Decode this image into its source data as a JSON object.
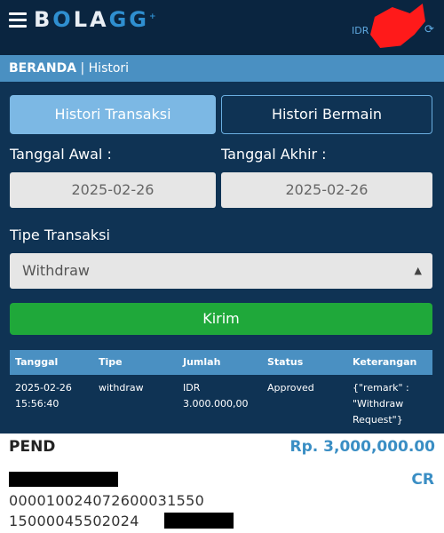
{
  "header": {
    "logo_text": "BOLAGG",
    "currency": "IDR",
    "refresh_icon": "refresh-icon"
  },
  "breadcrumb": {
    "home": "BERANDA",
    "separator": " | ",
    "current": "Histori"
  },
  "tabs": [
    {
      "label": "Histori Transaksi",
      "active": true
    },
    {
      "label": "Histori Bermain",
      "active": false
    }
  ],
  "filters": {
    "start_label": "Tanggal Awal :",
    "start_value": "2025-02-26",
    "end_label": "Tanggal Akhir :",
    "end_value": "2025-02-26",
    "type_label": "Tipe Transaksi",
    "type_value": "Withdraw",
    "submit_label": "Kirim"
  },
  "table": {
    "headers": [
      "Tanggal",
      "Tipe",
      "Jumlah",
      "Status",
      "Keterangan"
    ],
    "rows": [
      {
        "date": "2025-02-26",
        "time": "15:56:40",
        "type": "withdraw",
        "amount_currency": "IDR",
        "amount_value": "3.000.000,00",
        "status": "Approved",
        "note_line1": "{\"remark\" :",
        "note_line2": "\"Withdraw",
        "note_line3": "Request\"}"
      }
    ]
  },
  "receipt": {
    "status": "PEND",
    "amount": "Rp. 3,000,000.00",
    "direction": "CR",
    "ref1": "000010024072600031550",
    "ref2": "15000045502024"
  },
  "colors": {
    "background": "#0f3354",
    "accent": "#4a90c2",
    "submit": "#1fa83a",
    "redaction_red": "#ff1a1a"
  }
}
